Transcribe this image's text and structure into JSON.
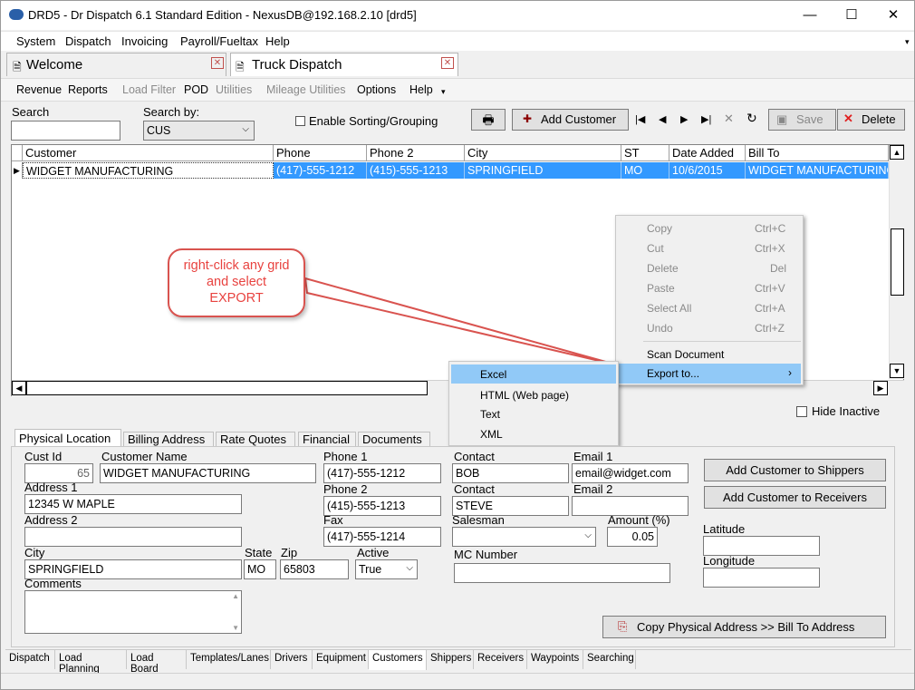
{
  "window": {
    "title": "DRD5 - Dr Dispatch 6.1 Standard Edition - NexusDB@192.168.2.10 [drd5]",
    "min": "—",
    "max": "☐",
    "close": "✕"
  },
  "menu": [
    "System",
    "Dispatch",
    "Invoicing",
    "Payroll/Fueltax",
    "Help"
  ],
  "doc_tabs": [
    "Welcome",
    "Truck Dispatch"
  ],
  "toolbar": {
    "revenue": "Revenue",
    "reports": "Reports",
    "load_filter": "Load Filter",
    "pod": "POD",
    "utilities": "Utilities",
    "mileage": "Mileage Utilities",
    "options": "Options",
    "help": "Help"
  },
  "search": {
    "label": "Search",
    "value": "",
    "by_label": "Search by:",
    "by_value": "CUS",
    "enable_sorting": "Enable Sorting/Grouping"
  },
  "actions": {
    "add_customer": "Add Customer",
    "save": "Save",
    "delete": "Delete"
  },
  "grid": {
    "columns": [
      "Customer",
      "Phone",
      "Phone 2",
      "City",
      "ST",
      "Date Added",
      "Bill To"
    ],
    "row": [
      "WIDGET MANUFACTURING",
      "(417)-555-1212",
      "(415)-555-1213",
      "SPRINGFIELD",
      "MO",
      "10/6/2015",
      "WIDGET MANUFACTURING"
    ]
  },
  "context_menu": {
    "items": [
      {
        "label": "Copy",
        "shortcut": "Ctrl+C"
      },
      {
        "label": "Cut",
        "shortcut": "Ctrl+X"
      },
      {
        "label": "Delete",
        "shortcut": "Del"
      },
      {
        "label": "Paste",
        "shortcut": "Ctrl+V"
      },
      {
        "label": "Select All",
        "shortcut": "Ctrl+A"
      },
      {
        "label": "Undo",
        "shortcut": "Ctrl+Z"
      }
    ],
    "scan": "Scan Document",
    "export": "Export to...",
    "submenu": [
      "Excel",
      "HTML (Web page)",
      "Text",
      "XML"
    ]
  },
  "callout": {
    "line1": "right-click any grid",
    "line2": "and select",
    "line3": "EXPORT"
  },
  "hide_inactive": "Hide Inactive",
  "detail_tabs": [
    "Physical Location",
    "Billing Address",
    "Rate Quotes",
    "Financial",
    "Documents"
  ],
  "form": {
    "cust_id_label": "Cust Id",
    "cust_id": "65",
    "name_label": "Customer Name",
    "name": "WIDGET MANUFACTURING",
    "addr1_label": "Address 1",
    "addr1": "12345 W MAPLE",
    "addr2_label": "Address 2",
    "addr2": "",
    "city_label": "City",
    "city": "SPRINGFIELD",
    "state_label": "State",
    "state": "MO",
    "zip_label": "Zip",
    "zip": "65803",
    "active_label": "Active",
    "active": "True",
    "comments_label": "Comments",
    "phone1_label": "Phone 1",
    "phone1": "(417)-555-1212",
    "phone2_label": "Phone 2",
    "phone2": "(415)-555-1213",
    "fax_label": "Fax",
    "fax": "(417)-555-1214",
    "contact1_label": "Contact",
    "contact1": "BOB",
    "contact2_label": "Contact",
    "contact2": "STEVE",
    "email1_label": "Email 1",
    "email1": "email@widget.com",
    "email2_label": "Email 2",
    "email2": "",
    "salesman_label": "Salesman",
    "amount_label": "Amount (%)",
    "amount": "0.05",
    "mc_label": "MC Number",
    "lat_label": "Latitude",
    "lon_label": "Longitude",
    "add_shippers": "Add Customer to Shippers",
    "add_receivers": "Add Customer to Receivers",
    "copy_address": "Copy Physical Address >> Bill To Address"
  },
  "bottom_tabs": [
    "Dispatch",
    "Load Planning",
    "Load Board",
    "Templates/Lanes",
    "Drivers",
    "Equipment",
    "Customers",
    "Shippers",
    "Receivers",
    "Waypoints",
    "Searching"
  ],
  "colors": {
    "selection": "#3399ff",
    "callout": "#d9534f",
    "menu_highlight": "#91c9f7"
  }
}
